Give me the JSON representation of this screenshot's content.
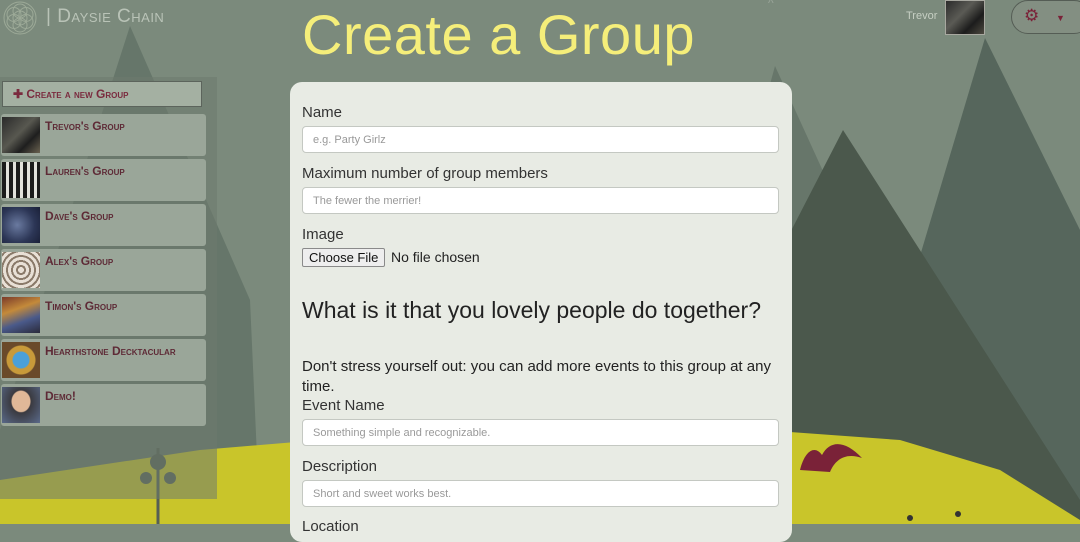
{
  "header": {
    "brand": "| Daysie Chain",
    "page_title": "Create a Group",
    "user_name": "Trevor",
    "logo_icon": "flower-of-life-icon",
    "settings_icon": "gear-icon"
  },
  "sidebar": {
    "create_label": "✚ Create a new Group",
    "groups": [
      {
        "label": "Trevor's Group"
      },
      {
        "label": "Lauren's Group"
      },
      {
        "label": "Dave's Group"
      },
      {
        "label": "Alex's Group"
      },
      {
        "label": "Timon's Group"
      },
      {
        "label": "Hearthstone Decktacular"
      },
      {
        "label": "Demo!"
      }
    ]
  },
  "form": {
    "name_label": "Name",
    "name_placeholder": "e.g. Party Girlz",
    "max_label": "Maximum number of group members",
    "max_placeholder": "The fewer the merrier!",
    "image_label": "Image",
    "file_button": "Choose File",
    "file_status": "No file chosen",
    "events_heading": "What is it that you lovely people do together?",
    "events_hint": "Don't stress yourself out: you can add more events to this group at any time.",
    "event_name_label": "Event Name",
    "event_name_placeholder": "Something simple and recognizable.",
    "description_label": "Description",
    "description_placeholder": "Short and sweet works best.",
    "location_label": "Location"
  },
  "colors": {
    "title": "#f5ee7a",
    "accent": "#7a2238",
    "sky": "#7b8a7c",
    "hill": "#c9c52a"
  }
}
